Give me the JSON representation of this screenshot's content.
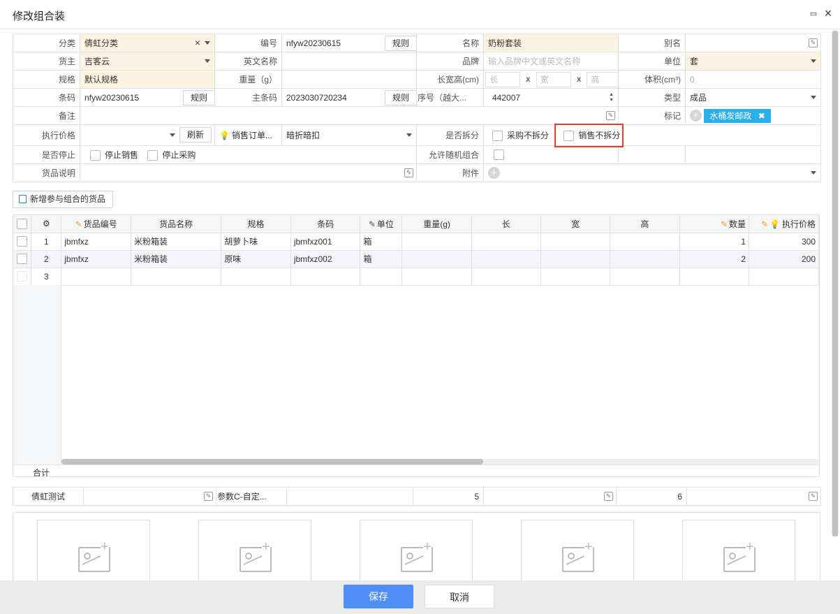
{
  "window": {
    "title": "修改组合装"
  },
  "form": {
    "category": {
      "label": "分类",
      "value": "倩虹分类"
    },
    "code": {
      "label": "编号",
      "value": "nfyw20230615",
      "rule_btn": "规则"
    },
    "name": {
      "label": "名称",
      "value": "奶粉套装"
    },
    "alias": {
      "label": "别名",
      "value": ""
    },
    "owner": {
      "label": "货主",
      "value": "吉客云"
    },
    "en_name": {
      "label": "英文名称",
      "value": ""
    },
    "brand": {
      "label": "品牌",
      "placeholder": "输入品牌中文或英文名称"
    },
    "unit": {
      "label": "单位",
      "value": "套"
    },
    "spec": {
      "label": "规格",
      "value": "默认规格"
    },
    "weight": {
      "label": "重量（g）",
      "value": ""
    },
    "lwh": {
      "label": "长宽高(cm)",
      "l": "长",
      "w": "宽",
      "h": "高",
      "x": "x"
    },
    "volume": {
      "label": "体积(cm³)",
      "value": "0"
    },
    "barcode": {
      "label": "条码",
      "value": "nfyw20230615",
      "rule_btn": "规则"
    },
    "main_barcode": {
      "label": "主条码",
      "value": "2023030720234",
      "rule_btn": "规则"
    },
    "serial": {
      "label": "序号（越大...",
      "value": "442007"
    },
    "type": {
      "label": "类型",
      "value": "成品"
    },
    "remark": {
      "label": "备注",
      "value": ""
    },
    "mark": {
      "label": "标记",
      "tag": "水桶发邮政"
    },
    "exec_price": {
      "label": "执行价格",
      "refresh_btn": "刷新",
      "sales_order_label": "销售订单...",
      "discount_value": "暗折暗扣"
    },
    "split": {
      "label": "是否拆分",
      "purchase_no_split": "采购不拆分",
      "sales_no_split": "销售不拆分"
    },
    "stop": {
      "label": "是否停止",
      "stop_sales": "停止销售",
      "stop_purchase": "停止采购"
    },
    "random_combo": {
      "label": "允许随机组合"
    },
    "desc": {
      "label": "货品说明",
      "value": ""
    },
    "attachment": {
      "label": "附件"
    }
  },
  "add_goods_btn": "新增参与组合的货品",
  "grid": {
    "headers": [
      "货品编号",
      "货品名称",
      "规格",
      "条码",
      "单位",
      "重量(g)",
      "长",
      "宽",
      "高",
      "数量",
      "执行价格"
    ],
    "rows": [
      {
        "no": "1",
        "code": "jbmfxz",
        "name": "米粉箱装",
        "spec": "胡萝卜味",
        "barcode": "jbmfxz001",
        "unit": "箱",
        "weight": "",
        "l": "",
        "w": "",
        "h": "",
        "qty": "1",
        "price": "300"
      },
      {
        "no": "2",
        "code": "jbmfxz",
        "name": "米粉箱装",
        "spec": "原味",
        "barcode": "jbmfxz002",
        "unit": "箱",
        "weight": "",
        "l": "",
        "w": "",
        "h": "",
        "qty": "2",
        "price": "200"
      },
      {
        "no": "3",
        "code": "",
        "name": "",
        "spec": "",
        "barcode": "",
        "unit": "",
        "weight": "",
        "l": "",
        "w": "",
        "h": "",
        "qty": "",
        "price": ""
      }
    ],
    "total_label": "合计"
  },
  "custom_fields": {
    "f1_label": "倩虹测试",
    "f1_value": "",
    "f2_label": "参数C-自定...",
    "f2_value": "",
    "v5": "5",
    "v6": "6"
  },
  "footer": {
    "save": "保存",
    "cancel": "取消"
  }
}
